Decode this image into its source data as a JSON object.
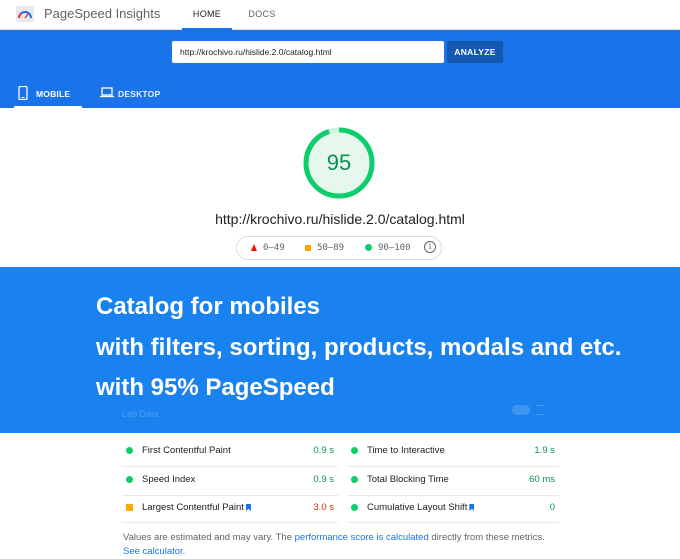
{
  "nav": {
    "brand": "PageSpeed Insights",
    "tabs": [
      "HOME",
      "DOCS"
    ]
  },
  "url_form": {
    "value": "http://krochivo.ru/hislide.2.0/catalog.html",
    "analyze_label": "ANALYZE"
  },
  "device_tabs": [
    {
      "label": "MOBILE",
      "icon": "phone-icon",
      "selected": true
    },
    {
      "label": "DESKTOP",
      "icon": "laptop-icon",
      "selected": false
    }
  ],
  "score": {
    "value": "95",
    "fraction": 0.95,
    "tested_url": "http://krochivo.ru/hislide.2.0/catalog.html",
    "legend": [
      "0–49",
      "50–89",
      "90–100"
    ]
  },
  "banner": {
    "lines": [
      "Catalog for mobiles",
      "with filters, sorting, products, modals and etc.",
      "with 95% PageSpeed"
    ],
    "ghost_label": "Lab Data"
  },
  "metrics": [
    {
      "name": "First Contentful Paint",
      "value": "0.9 s",
      "status": "pass"
    },
    {
      "name": "Time to Interactive",
      "value": "1.9 s",
      "status": "pass"
    },
    {
      "name": "Speed Index",
      "value": "0.9 s",
      "status": "pass"
    },
    {
      "name": "Total Blocking Time",
      "value": "60 ms",
      "status": "pass"
    },
    {
      "name": "Largest Contentful Paint",
      "value": "3.0 s",
      "status": "average"
    },
    {
      "name": "Cumulative Layout Shift",
      "value": "0",
      "status": "pass"
    }
  ],
  "footnote": {
    "text1": "Values are estimated and may vary. The ",
    "link1": "performance score is calculated",
    "text2": " directly from these metrics. ",
    "link2": "See calculator."
  },
  "colors": {
    "accent": "#1a73e8",
    "pass": "#0cce6b",
    "average": "#ffa400",
    "fail": "#eb0f00"
  }
}
